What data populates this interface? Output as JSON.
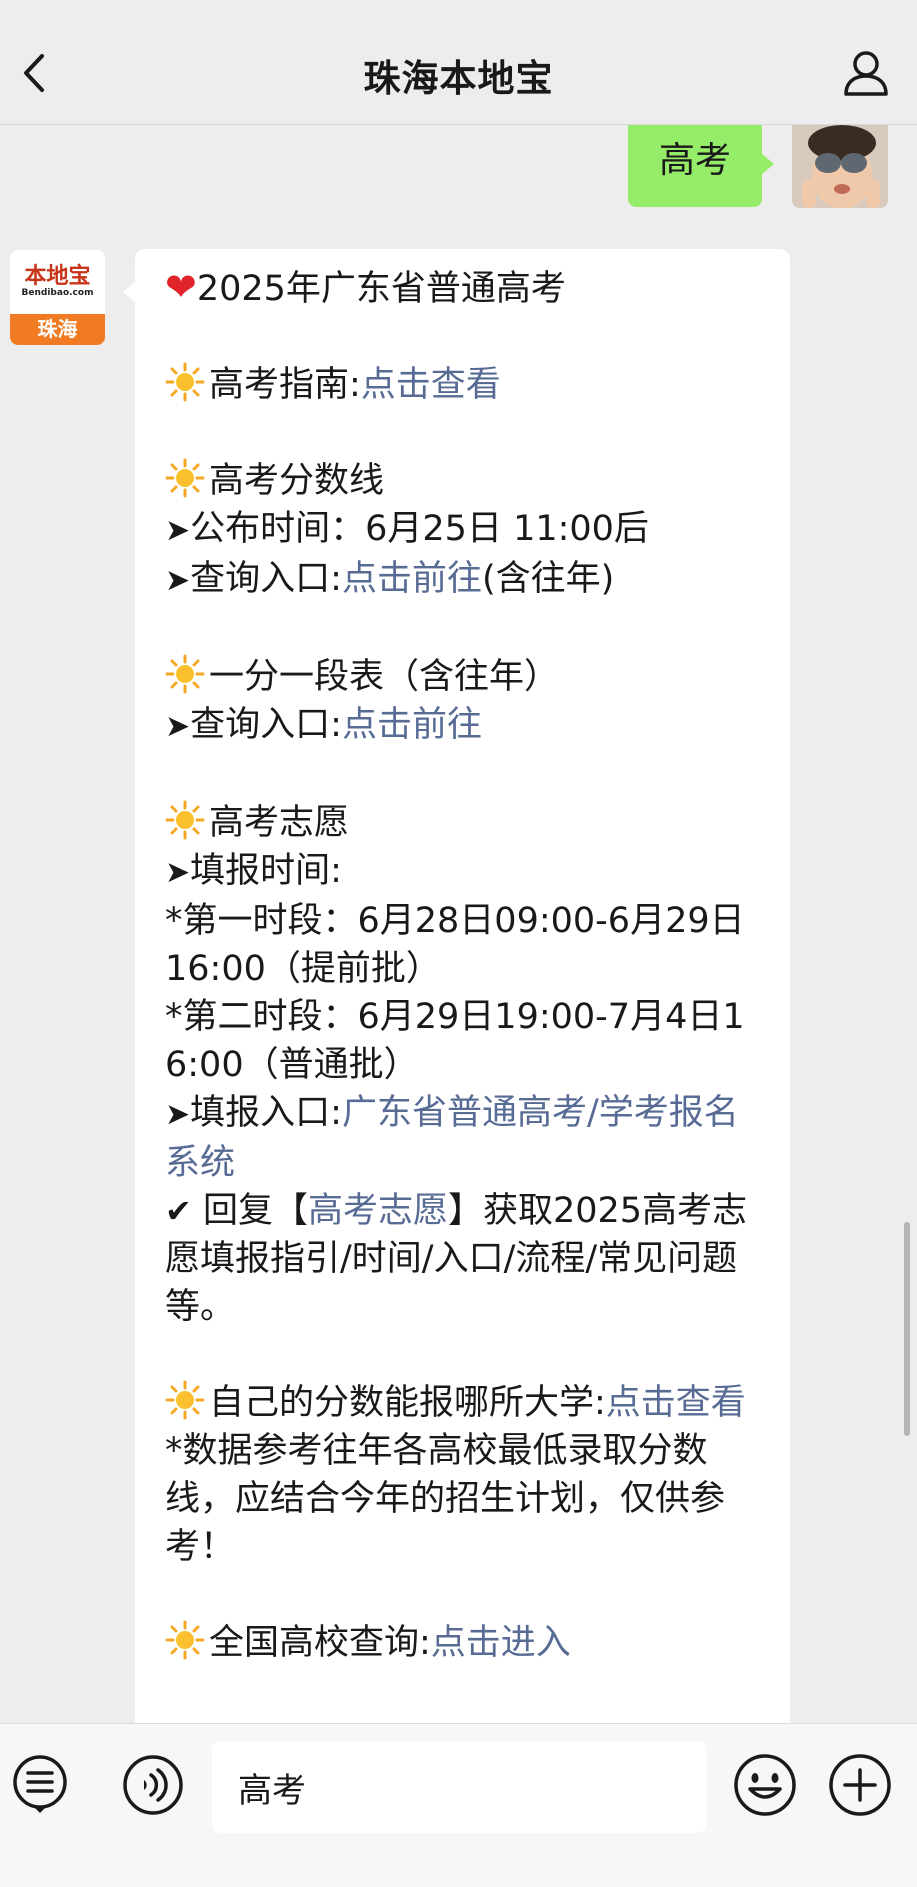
{
  "header": {
    "title": "珠海本地宝",
    "back_icon": "chevron-left-icon",
    "profile_icon": "person-icon"
  },
  "sent": {
    "text": "高考"
  },
  "bot_avatar": {
    "brand": "本地宝",
    "domain": "Bendibao.com",
    "city": "珠海"
  },
  "message": {
    "heart_title": "2025年广东省普通高考",
    "guide_label": "高考指南:",
    "guide_link": "点击查看",
    "scores_heading": "高考分数线",
    "publish_time": "公布时间：6月25日 11:00后",
    "score_query_label": "查询入口:",
    "score_query_link": "点击前往",
    "score_query_suffix": "(含往年)",
    "segment_heading": "一分一段表（含往年）",
    "segment_query_label": "查询入口:",
    "segment_query_link": "点击前往",
    "apply_heading": "高考志愿",
    "apply_time_label": "填报时间:",
    "period_one": "*第一时段：6月28日09:00-6月29日16:00（提前批）",
    "period_two": "*第二时段：6月29日19:00-7月4日16:00（普通批）",
    "apply_entry_label": "填报入口:",
    "apply_entry_link": "广东省普通高考/学考报名系统",
    "reply_prefix": "回复【",
    "reply_keyword": "高考志愿",
    "reply_suffix": "】获取2025高考志愿填报指引/时间/入口/流程/常见问题等。",
    "university_label": "自己的分数能报哪所大学:",
    "university_link": "点击查看",
    "data_note": "*数据参考往年各高校最低录取分数线，应结合今年的招生计划，仅供参考！",
    "colleges_label": "全国高校查询:",
    "colleges_link": "点击进入"
  },
  "input_bar": {
    "value": "高考",
    "menu_icon": "menu-list-icon",
    "voice_icon": "voice-icon",
    "emoji_icon": "emoji-icon",
    "plus_icon": "plus-icon"
  },
  "colors": {
    "link": "#576b95",
    "sent_bubble": "#95ec69",
    "background": "#ededed"
  }
}
